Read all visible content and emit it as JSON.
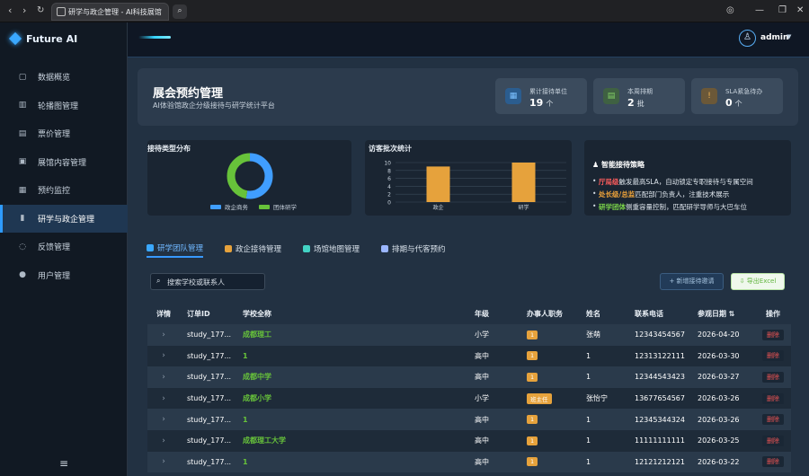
{
  "browser": {
    "tab_title": "研学与政企管理 - AI科技展馆"
  },
  "brand": {
    "name": "Future AI"
  },
  "sidebar": {
    "items": [
      {
        "label": "数据概览",
        "icon": "cart-icon"
      },
      {
        "label": "轮播图管理",
        "icon": "building-icon"
      },
      {
        "label": "票价管理",
        "icon": "ticket-icon"
      },
      {
        "label": "展馆内容管理",
        "icon": "image-icon"
      },
      {
        "label": "预约监控",
        "icon": "calendar-icon"
      },
      {
        "label": "研学与政企管理",
        "icon": "chart-icon"
      },
      {
        "label": "反馈管理",
        "icon": "chat-icon"
      },
      {
        "label": "用户管理",
        "icon": "user-icon"
      }
    ],
    "active_index": 5
  },
  "topbar": {
    "user": "admin"
  },
  "hero": {
    "title": "展会预约管理",
    "subtitle": "AI体验馆政企分级接待与研学统计平台",
    "stats": [
      {
        "label": "累计接待单位",
        "value": "19",
        "unit": "个",
        "color": "#4ea6ff"
      },
      {
        "label": "本周排期",
        "value": "2",
        "unit": "批",
        "color": "#67c23a"
      },
      {
        "label": "SLA紧急待办",
        "value": "0",
        "unit": "个",
        "color": "#e6a23c"
      }
    ]
  },
  "charts": {
    "donut_title": "接待类型分布",
    "bar_title": "访客批次统计"
  },
  "chart_data": [
    {
      "type": "pie",
      "title": "接待类型分布",
      "series": [
        {
          "name": "政企商务",
          "value": 10,
          "color": "#409eff"
        },
        {
          "name": "团体研学",
          "value": 9,
          "color": "#67c23a"
        }
      ]
    },
    {
      "type": "bar",
      "title": "访客批次统计",
      "categories": [
        "政企",
        "研学"
      ],
      "values": [
        9,
        10
      ],
      "ylim": [
        0,
        10
      ],
      "yticks": [
        0,
        2,
        4,
        6,
        8,
        10
      ],
      "color": "#e6a23c"
    }
  ],
  "strategy": {
    "title": "智能接待策略",
    "lines": [
      {
        "highlight": "厅局级",
        "text": "触发最高SLA，自动锁定专职接待与专属空间",
        "color": "#ff5d5d"
      },
      {
        "highlight": "处长级/总监",
        "text": "匹配部门负责人，注重技术展示",
        "color": "#f0a43a"
      },
      {
        "highlight": "研学团体",
        "text": "侧重容量控制，匹配研学导师与大巴车位",
        "color": "#7bd44a"
      }
    ]
  },
  "tabs": [
    {
      "label": "研学团队管理",
      "icon_color": "#3aa8ff"
    },
    {
      "label": "政企接待管理",
      "icon_color": "#e6a23c"
    },
    {
      "label": "场馆地图管理",
      "icon_color": "#43d3c4"
    },
    {
      "label": "排期与代客预约",
      "icon_color": "#9bb6ff"
    }
  ],
  "toolbar": {
    "search_placeholder": "搜索学校或联系人",
    "add_label": "+ 新增接待邀请",
    "export_label": "导出Excel"
  },
  "table": {
    "headers": [
      "详情",
      "订单ID",
      "学校全称",
      "年级",
      "办事人职务",
      "姓名",
      "联系电话",
      "参观日期",
      "操作"
    ],
    "rows": [
      {
        "id": "study_177...",
        "school": "成都理工",
        "grade": "小学",
        "role": "1",
        "name": "张萌",
        "phone": "12343454567",
        "date": "2026-04-20",
        "action": "删除"
      },
      {
        "id": "study_177...",
        "school": "1",
        "grade": "高中",
        "role": "1",
        "name": "1",
        "phone": "12313122111",
        "date": "2026-03-30",
        "action": "删除"
      },
      {
        "id": "study_177...",
        "school": "成都中学",
        "grade": "高中",
        "role": "1",
        "name": "1",
        "phone": "12344543423",
        "date": "2026-03-27",
        "action": "删除"
      },
      {
        "id": "study_177...",
        "school": "成都小学",
        "grade": "小学",
        "role": "班主任",
        "name": "张怡宁",
        "phone": "13677654567",
        "date": "2026-03-26",
        "action": "删除"
      },
      {
        "id": "study_177...",
        "school": "1",
        "grade": "高中",
        "role": "1",
        "name": "1",
        "phone": "12345344324",
        "date": "2026-03-26",
        "action": "删除"
      },
      {
        "id": "study_177...",
        "school": "成都理工大学",
        "grade": "高中",
        "role": "1",
        "name": "1",
        "phone": "11111111111",
        "date": "2026-03-25",
        "action": "删除"
      },
      {
        "id": "study_177...",
        "school": "1",
        "grade": "高中",
        "role": "1",
        "name": "1",
        "phone": "12121212121",
        "date": "2026-03-22",
        "action": "删除"
      }
    ]
  }
}
